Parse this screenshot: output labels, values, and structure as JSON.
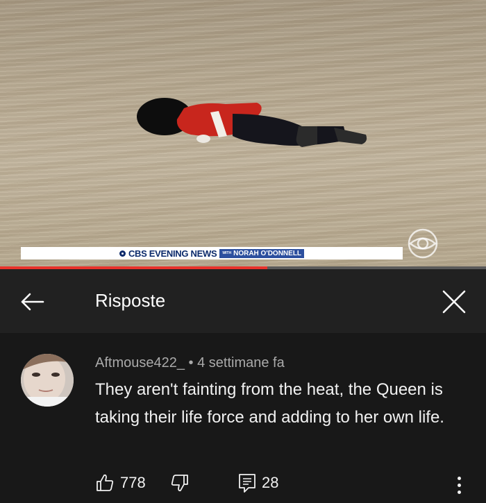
{
  "video": {
    "chyron_show": "CBS EVENING NEWS",
    "chyron_with": "WITH",
    "chyron_anchor": "NORAH O'DONNELL",
    "progress": 0.55,
    "accent": "#e8322b"
  },
  "header": {
    "back_icon": "arrow-left-icon",
    "title": "Risposte",
    "close_icon": "close-icon"
  },
  "comment": {
    "author": "Aftmouse422_",
    "separator": " • ",
    "time": "4 settimane fa",
    "text": "They aren't fainting from the heat, the Queen is taking their life force and adding to her own life.",
    "likes": "778",
    "replies": "28",
    "icons": {
      "like": "thumbs-up-icon",
      "dislike": "thumbs-down-icon",
      "reply": "reply-icon",
      "more": "more-vertical-icon"
    }
  }
}
